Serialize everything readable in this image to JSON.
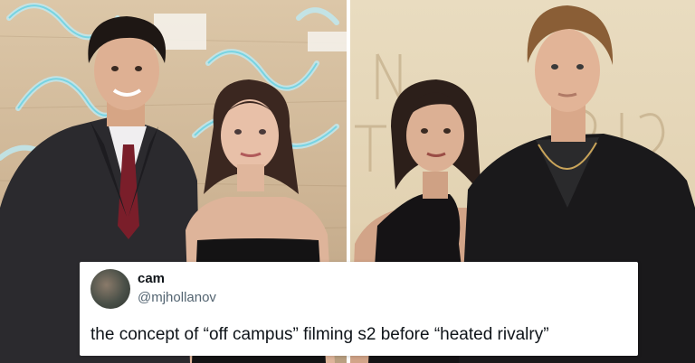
{
  "tweet": {
    "display_name": "cam",
    "handle": "@mjhollanov",
    "text": "the concept of “off campus” filming s2 before “heated rivalry”"
  },
  "photos": {
    "left": "two people posing at a premiere in front of a neon-sign wall",
    "right": "two people posing at a premiere in front of a beige lettered wall"
  }
}
